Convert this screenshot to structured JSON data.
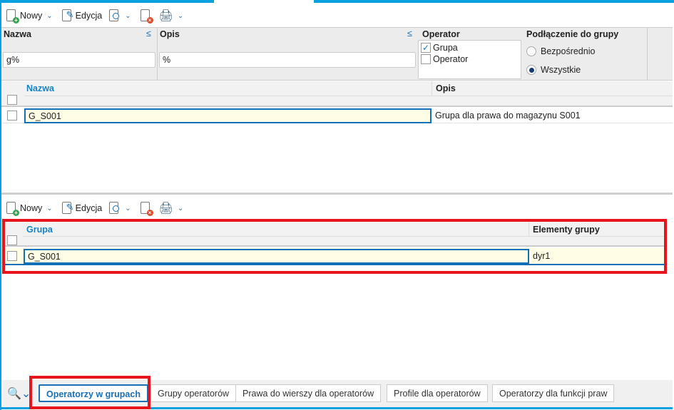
{
  "toolbar": {
    "new_label": "Nowy",
    "edit_label": "Edycja"
  },
  "filters": {
    "nazwa_label": "Nazwa",
    "nazwa_value": "g%",
    "opis_label": "Opis",
    "opis_value": "%",
    "operator_label": "Operator",
    "operator_options": [
      {
        "label": "Grupa",
        "checked": true
      },
      {
        "label": "Operator",
        "checked": false
      }
    ],
    "group_label": "Podłączenie do grupy",
    "group_options": [
      {
        "label": "Bezpośrednio",
        "selected": false
      },
      {
        "label": "Wszystkie",
        "selected": true
      }
    ],
    "le_symbol": "≤"
  },
  "grid1": {
    "columns": [
      "Nazwa",
      "Opis"
    ],
    "rows": [
      {
        "nazwa": "G_S001",
        "opis": "Grupa dla prawa do magazynu S001"
      }
    ]
  },
  "toolbar2": {
    "new_label": "Nowy",
    "edit_label": "Edycja"
  },
  "grid2": {
    "columns": [
      "Grupa",
      "Elementy grupy"
    ],
    "rows": [
      {
        "grupa": "G_S001",
        "elementy": "dyr1"
      }
    ]
  },
  "tabs": [
    "Operatorzy w grupach",
    "Grupy operatorów",
    "Prawa do wierszy dla operatorów",
    "Profile dla operatorów",
    "Operatorzy dla funkcji praw"
  ],
  "colors": {
    "accent": "#0aa0e0",
    "highlight": "#e8141c",
    "selected_row": "#fffde5"
  }
}
